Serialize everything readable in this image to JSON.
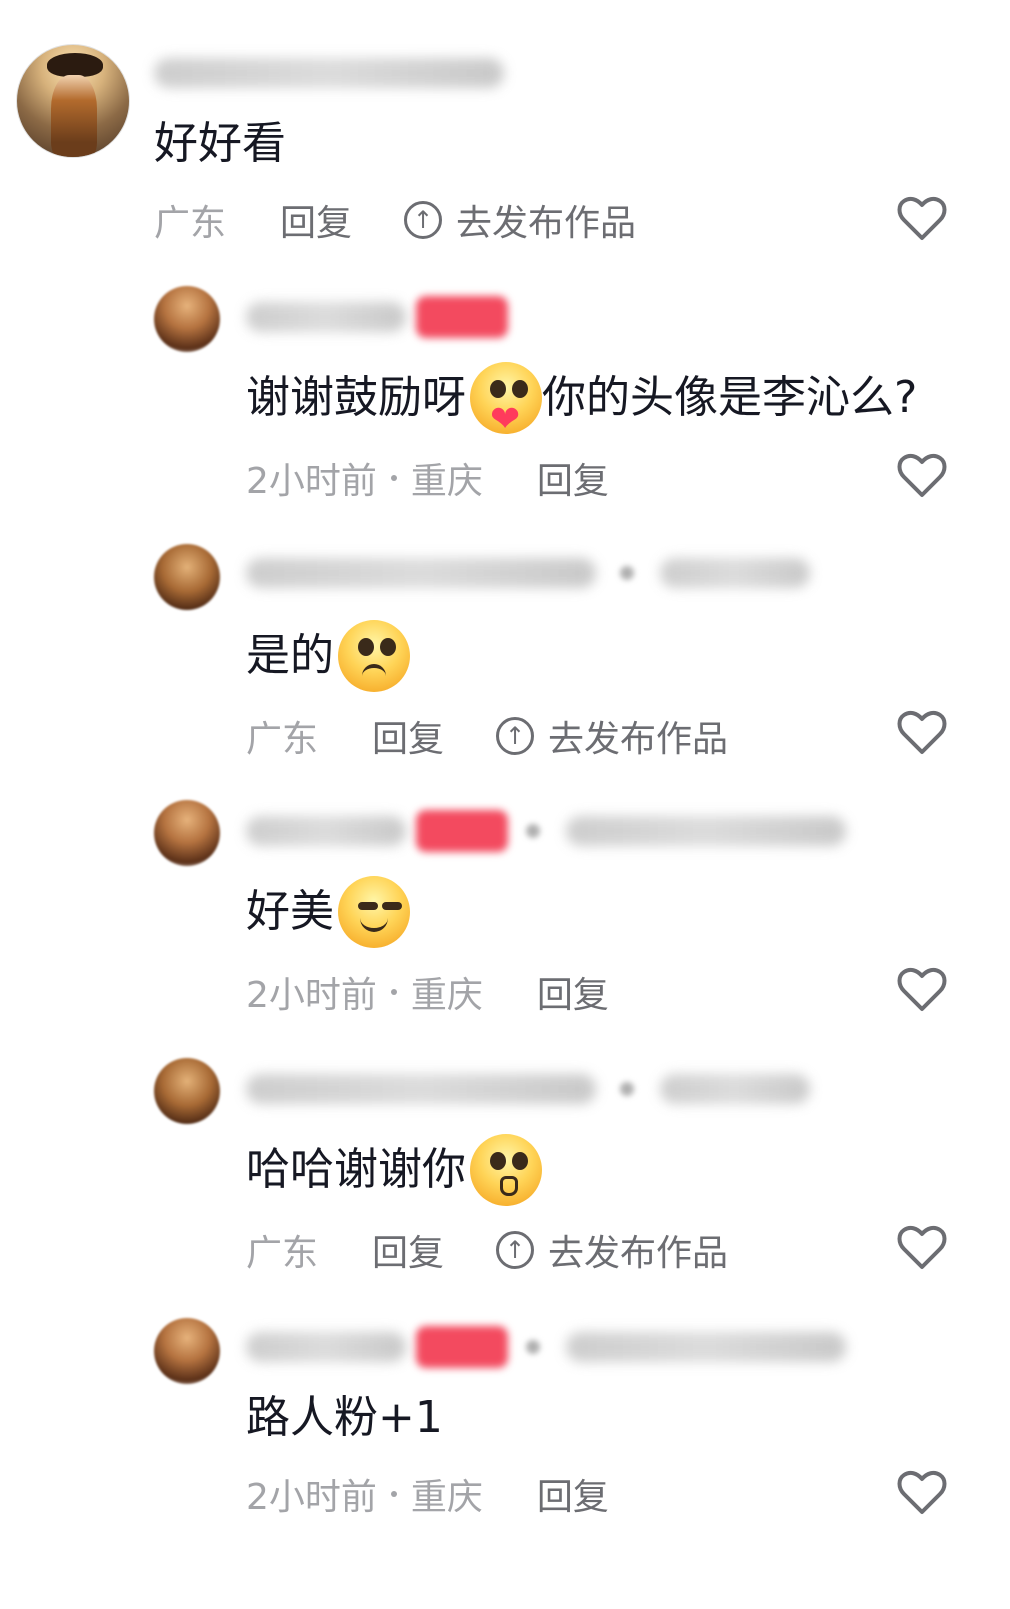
{
  "comments": [
    {
      "id": "c1",
      "level": "top",
      "text": "好好看",
      "location": "广东",
      "reply_label": "回复",
      "publish_label": "去发布作品",
      "has_publish": true
    },
    {
      "id": "c2",
      "level": "reply",
      "text": "谢谢鼓励呀",
      "emoji_semantic": "pleading-face-with-heart",
      "text_after_emoji": "你的头像是李沁么?",
      "time": "2小时前",
      "location": "重庆",
      "reply_label": "回复",
      "has_publish": false
    },
    {
      "id": "c3",
      "level": "reply",
      "text": "是的",
      "emoji_semantic": "pleading-face",
      "location": "广东",
      "reply_label": "回复",
      "publish_label": "去发布作品",
      "has_publish": true
    },
    {
      "id": "c4",
      "level": "reply",
      "text": "好美",
      "emoji_semantic": "smirk-face",
      "time": "2小时前",
      "location": "重庆",
      "reply_label": "回复",
      "has_publish": false
    },
    {
      "id": "c5",
      "level": "reply",
      "text": "哈哈谢谢你",
      "emoji_semantic": "kissing-face",
      "location": "广东",
      "reply_label": "回复",
      "publish_label": "去发布作品",
      "has_publish": true
    },
    {
      "id": "c6",
      "level": "reply",
      "text": "路人粉+1",
      "time": "2小时前",
      "location": "重庆",
      "reply_label": "回复",
      "has_publish": false
    }
  ],
  "colors": {
    "text_primary": "#161823",
    "text_secondary": "#a3a4a8",
    "reply_link": "#6c6d72",
    "badge_red": "#f34a5f",
    "heart_outline": "#6c6d72"
  },
  "icons": {
    "like": "heart-outline-icon",
    "publish": "upload-circle-icon"
  }
}
